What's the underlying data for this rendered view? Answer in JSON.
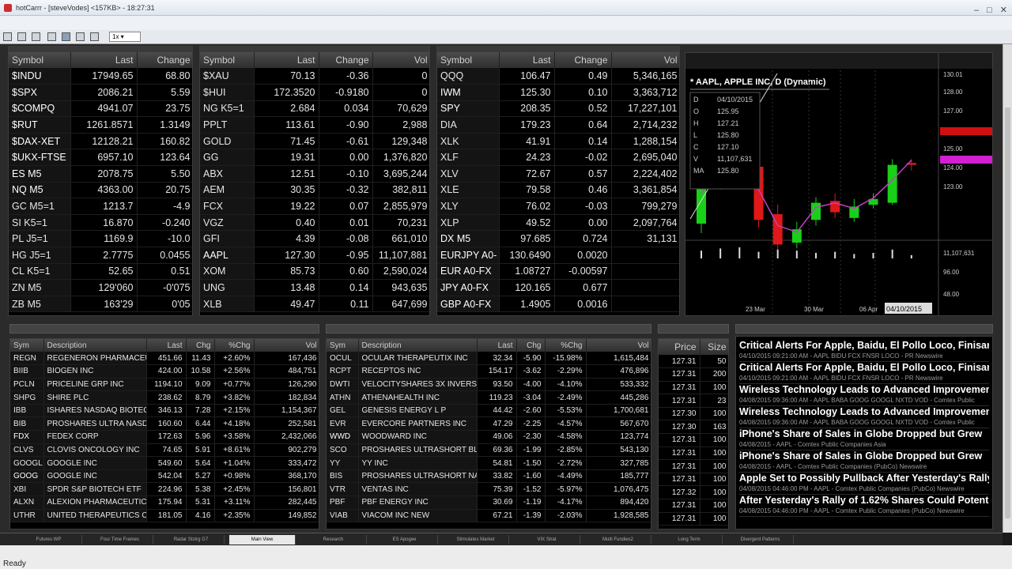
{
  "window": {
    "title": "hotCarrr - [steveVodes] <157KB> - 18:27:31"
  },
  "toolbar": {
    "zoom": "1x"
  },
  "watch1": {
    "headers": [
      "Symbol",
      "Last",
      "Change"
    ],
    "rows": [
      [
        "$INDU",
        "17949.65",
        "68.80",
        "g",
        "pos"
      ],
      [
        "$SPX",
        "2086.21",
        "5.59",
        "r",
        "pos"
      ],
      [
        "$COMPQ",
        "4941.07",
        "23.75",
        "r",
        "pos"
      ],
      [
        "$RUT",
        "1261.8571",
        "1.3149",
        "r",
        "pos"
      ],
      [
        "$DAX-XET",
        "12128.21",
        "160.82",
        "r",
        "pos"
      ],
      [
        "$UKX-FTSE",
        "6957.10",
        "123.64",
        "g",
        "pos"
      ],
      [
        "ES M5",
        "2078.75",
        "5.50",
        "g",
        "pos"
      ],
      [
        "NQ M5",
        "4363.00",
        "20.75",
        "g",
        "pos"
      ],
      [
        "GC M5=1",
        "1213.7",
        "-4.9",
        "d",
        "neg"
      ],
      [
        "SI K5=1",
        "16.870",
        "-0.240",
        "d",
        "neg"
      ],
      [
        "PL J5=1",
        "1169.9",
        "-10.0",
        "d",
        "neg"
      ],
      [
        "HG J5=1",
        "2.7775",
        "0.0455",
        "d",
        "pos"
      ],
      [
        "CL K5=1",
        "52.65",
        "0.51",
        "d",
        "pos"
      ],
      [
        "ZN M5",
        "129'060",
        "-0'075",
        "d",
        "neg"
      ],
      [
        "ZB M5",
        "163'29",
        "0'05",
        "d",
        "pos"
      ]
    ]
  },
  "watch2": {
    "headers": [
      "Symbol",
      "Last",
      "Change",
      "Vol"
    ],
    "rows": [
      [
        "$XAU",
        "70.13",
        "-0.36",
        "0",
        "d",
        "neg"
      ],
      [
        "$HUI",
        "172.3520",
        "-0.9180",
        "0",
        "d",
        "neg"
      ],
      [
        "NG K5=1",
        "2.684",
        "0.034",
        "70,629",
        "d",
        "pos"
      ],
      [
        "PPLT",
        "113.61",
        "-0.90",
        "2,988",
        "d",
        "neg"
      ],
      [
        "GOLD",
        "71.45",
        "-0.61",
        "129,348",
        "d",
        "neg"
      ],
      [
        "GG",
        "19.31",
        "0.00",
        "1,376,820",
        "d",
        "neu"
      ],
      [
        "ABX",
        "12.51",
        "-0.10",
        "3,695,244",
        "d",
        "neg"
      ],
      [
        "AEM",
        "30.35",
        "-0.32",
        "382,811",
        "d",
        "neg"
      ],
      [
        "FCX",
        "19.22",
        "0.07",
        "2,855,979",
        "d",
        "pos"
      ],
      [
        "VGZ",
        "0.40",
        "0.01",
        "70,231",
        "d",
        "pos"
      ],
      [
        "GFI",
        "4.39",
        "-0.08",
        "661,010",
        "d",
        "neg"
      ],
      [
        "AAPL",
        "127.30",
        "-0.95",
        "11,107,881",
        "r",
        "neg"
      ],
      [
        "XOM",
        "85.73",
        "0.60",
        "2,590,024",
        "d",
        "pos"
      ],
      [
        "UNG",
        "13.48",
        "0.14",
        "943,635",
        "d",
        "pos"
      ],
      [
        "XLB",
        "49.47",
        "0.11",
        "647,699",
        "d",
        "pos"
      ]
    ]
  },
  "watch3": {
    "headers": [
      "Symbol",
      "Last",
      "Change",
      "Vol"
    ],
    "rows": [
      [
        "QQQ",
        "106.47",
        "0.49",
        "5,346,165",
        "d",
        "pos"
      ],
      [
        "IWM",
        "125.30",
        "0.10",
        "3,363,712",
        "g",
        "pos"
      ],
      [
        "SPY",
        "208.35",
        "0.52",
        "17,227,101",
        "g",
        "pos"
      ],
      [
        "DIA",
        "179.23",
        "0.64",
        "2,714,232",
        "d",
        "pos"
      ],
      [
        "XLK",
        "41.91",
        "0.14",
        "1,288,154",
        "d",
        "pos"
      ],
      [
        "XLF",
        "24.23",
        "-0.02",
        "2,695,040",
        "d",
        "neg"
      ],
      [
        "XLV",
        "72.67",
        "0.57",
        "2,224,402",
        "d",
        "pos"
      ],
      [
        "XLE",
        "79.58",
        "0.46",
        "3,361,854",
        "d",
        "pos"
      ],
      [
        "XLY",
        "76.02",
        "-0.03",
        "799,279",
        "d",
        "neg"
      ],
      [
        "XLP",
        "49.52",
        "0.00",
        "2,097,764",
        "d",
        "neu"
      ],
      [
        "DX M5",
        "97.685",
        "0.724",
        "31,131",
        "g",
        "pos"
      ],
      [
        "EURJPY A0-",
        "130.6490",
        "0.0020",
        "",
        "r",
        "pos"
      ],
      [
        "EUR A0-FX",
        "1.08727",
        "-0.00597",
        "",
        "g",
        "neg"
      ],
      [
        "JPY A0-FX",
        "120.165",
        "0.677",
        "",
        "g",
        "pos"
      ],
      [
        "GBP A0-FX",
        "1.4905",
        "0.0016",
        "",
        "r",
        "pos"
      ]
    ]
  },
  "chart": {
    "title": "* AAPL, APPLE INC, D (Dynamic)",
    "date": "04/10/2015",
    "ohlc": [
      "D",
      "O",
      "H",
      "L",
      "C",
      "V",
      "MA"
    ],
    "ohlc_values": [
      "04/10/2015",
      "125.95",
      "127.21",
      "125.80",
      "127.10",
      "11,107,631",
      "125.80"
    ],
    "yaxis": [
      "130.01",
      "128.00",
      "127.00",
      "126.00",
      "125.00",
      "124.00",
      "123.00",
      "11,107,631",
      "96.00",
      "48.00"
    ],
    "xaxis": [
      "23 Mar",
      "30 Mar",
      "06 Apr",
      "04/10/2015"
    ],
    "candles": [
      [
        124.0,
        126.8,
        123.5,
        127.1
      ],
      [
        126.2,
        127.4,
        125.8,
        128.0
      ],
      [
        126.5,
        127.8,
        126.0,
        128.3
      ],
      [
        127.0,
        124.2,
        123.8,
        127.3
      ],
      [
        124.5,
        122.9,
        122.5,
        125.0
      ],
      [
        123.0,
        123.7,
        122.7,
        124.1
      ],
      [
        124.2,
        125.1,
        123.9,
        125.4
      ],
      [
        125.2,
        124.6,
        124.3,
        125.6
      ],
      [
        124.3,
        124.9,
        124.1,
        125.3
      ],
      [
        125.0,
        125.3,
        124.8,
        125.6
      ],
      [
        125.1,
        127.1,
        125.0,
        127.4
      ],
      [
        127.2,
        127.1,
        126.8,
        127.4
      ]
    ],
    "volumes": [
      0.7,
      0.9,
      1,
      0.6,
      0.8,
      0.7,
      0.5,
      0.6,
      0.4,
      0.5,
      0.8,
      0.3
    ]
  },
  "highlow": {
    "headers": [
      "Sym",
      "Description",
      "Last",
      "Chg",
      "%Chg",
      "Vol"
    ],
    "rows": [
      [
        "REGN",
        "REGENERON PHARMACEUT",
        "451.66",
        "11.43",
        "+2.60%",
        "167,436",
        "d",
        "pos"
      ],
      [
        "BIIB",
        "BIOGEN INC",
        "424.00",
        "10.58",
        "+2.56%",
        "484,751",
        "d",
        "pos"
      ],
      [
        "PCLN",
        "PRICELINE GRP INC",
        "1194.10",
        "9.09",
        "+0.77%",
        "126,290",
        "d",
        "pos"
      ],
      [
        "SHPG",
        "SHIRE PLC",
        "238.62",
        "8.79",
        "+3.82%",
        "182,834",
        "d",
        "pos"
      ],
      [
        "IBB",
        "ISHARES NASDAQ BIOTECH",
        "346.13",
        "7.28",
        "+2.15%",
        "1,154,367",
        "d",
        "pos"
      ],
      [
        "BIB",
        "PROSHARES ULTRA NASDAQ",
        "160.60",
        "6.44",
        "+4.18%",
        "252,581",
        "d",
        "pos"
      ],
      [
        "FDX",
        "FEDEX CORP",
        "172.63",
        "5.96",
        "+3.58%",
        "2,432,066",
        "r",
        "pos"
      ],
      [
        "CLVS",
        "CLOVIS ONCOLOGY INC",
        "74.65",
        "5.91",
        "+8.61%",
        "902,279",
        "d",
        "pos"
      ],
      [
        "GOOGL",
        "GOOGLE INC",
        "549.60",
        "5.64",
        "+1.04%",
        "333,472",
        "d",
        "pos"
      ],
      [
        "GOOG",
        "GOOGLE INC",
        "542.04",
        "5.27",
        "+0.98%",
        "368,170",
        "g",
        "pos"
      ],
      [
        "XBI",
        "SPDR S&P BIOTECH ETF",
        "224.96",
        "5.38",
        "+2.45%",
        "156,801",
        "d",
        "pos"
      ],
      [
        "ALXN",
        "ALEXION PHARMACEUTICAL",
        "175.94",
        "5.31",
        "+3.11%",
        "282,445",
        "d",
        "pos"
      ],
      [
        "UTHR",
        "UNITED THERAPEUTICS COR",
        "181.05",
        "4.16",
        "+2.35%",
        "149,852",
        "d",
        "pos"
      ]
    ]
  },
  "losers": {
    "headers": [
      "Sym",
      "Description",
      "Last",
      "Chg",
      "%Chg",
      "Vol"
    ],
    "rows": [
      [
        "OCUL",
        "OCULAR THERAPEUTIX INC",
        "32.34",
        "-5.90",
        "-15.98%",
        "1,615,484",
        "d",
        "neg"
      ],
      [
        "RCPT",
        "RECEPTOS INC",
        "154.17",
        "-3.62",
        "-2.29%",
        "476,896",
        "d",
        "neg"
      ],
      [
        "DWTI",
        "VELOCITYSHARES 3X INVERS",
        "93.50",
        "-4.00",
        "-4.10%",
        "533,332",
        "d",
        "neg"
      ],
      [
        "ATHN",
        "ATHENAHEALTH INC",
        "119.23",
        "-3.04",
        "-2.49%",
        "445,286",
        "d",
        "neg"
      ],
      [
        "GEL",
        "GENESIS ENERGY L P",
        "44.42",
        "-2.60",
        "-5.53%",
        "1,700,681",
        "d",
        "neg"
      ],
      [
        "EVR",
        "EVERCORE PARTNERS INC",
        "47.29",
        "-2.25",
        "-4.57%",
        "567,670",
        "d",
        "neg"
      ],
      [
        "WWD",
        "WOODWARD INC",
        "49.06",
        "-2.30",
        "-4.58%",
        "123,774",
        "g",
        "neg"
      ],
      [
        "SCO",
        "PROSHARES ULTRASHORT BL",
        "69.36",
        "-1.99",
        "-2.85%",
        "543,130",
        "d",
        "neg"
      ],
      [
        "YY",
        "YY INC",
        "54.81",
        "-1.50",
        "-2.72%",
        "327,785",
        "d",
        "neg"
      ],
      [
        "BIS",
        "PROSHARES ULTRASHORT NA",
        "33.82",
        "-1.60",
        "-4.49%",
        "185,777",
        "d",
        "neg"
      ],
      [
        "VTR",
        "VENTAS INC",
        "75.39",
        "-1.52",
        "-5.97%",
        "1,076,475",
        "d",
        "neg"
      ],
      [
        "PBF",
        "PBF ENERGY INC",
        "30.69",
        "-1.19",
        "-4.17%",
        "894,420",
        "d",
        "neg"
      ],
      [
        "VIAB",
        "VIACOM INC NEW",
        "67.21",
        "-1.39",
        "-2.03%",
        "1,928,585",
        "d",
        "neg"
      ]
    ]
  },
  "timesales": {
    "headers": [
      "Price",
      "Size"
    ],
    "rows": [
      [
        "127.31",
        "50"
      ],
      [
        "127.31",
        "200"
      ],
      [
        "127.31",
        "100"
      ],
      [
        "127.31",
        "23"
      ],
      [
        "127.30",
        "100"
      ],
      [
        "127.30",
        "163"
      ],
      [
        "127.31",
        "100"
      ],
      [
        "127.31",
        "100"
      ],
      [
        "127.31",
        "100"
      ],
      [
        "127.31",
        "100"
      ],
      [
        "127.32",
        "100"
      ],
      [
        "127.31",
        "100"
      ],
      [
        "127.31",
        "100"
      ]
    ]
  },
  "news": [
    {
      "headline": "Critical Alerts For Apple, Baidu, El Pollo Loco, Finisar",
      "meta": "04/10/2015 09:21:00 AM - AAPL BIDU FCX FNSR LOCO - PR Newswire"
    },
    {
      "headline": "Critical Alerts For Apple, Baidu, El Pollo Loco, Finisar",
      "meta": "04/10/2015 09:21:00 AM - AAPL BIDU FCX FNSR LOCO - PR Newswire"
    },
    {
      "headline": "Wireless Technology Leads to Advanced Improvements",
      "meta": "04/08/2015 09:36:00 AM - AAPL BABA GOOG GOOGL NXTD VOD - Comtex Public"
    },
    {
      "headline": "Wireless Technology Leads to Advanced Improvements",
      "meta": "04/08/2015 09:36:00 AM - AAPL BABA GOOG GOOGL NXTD VOD - Comtex Public"
    },
    {
      "headline": "iPhone's Share of Sales in Globe Dropped but Grew",
      "meta": "04/08/2015 - AAPL - Comtex Public Companies Asia"
    },
    {
      "headline": "iPhone's Share of Sales in Globe Dropped but Grew",
      "meta": "04/08/2015 - AAPL - Comtex Public Companies (PubCo) Newswire"
    },
    {
      "headline": "Apple Set to Possibly Pullback After Yesterday's Rally",
      "meta": "04/08/2015 04:46:00 PM - AAPL - Comtex Public Companies (PubCo) Newswire"
    },
    {
      "headline": "After Yesterday's Rally of 1.62% Shares Could Potentially",
      "meta": "04/08/2015 04:46:00 PM - AAPL - Comtex Public Companies (PubCo) Newswire"
    }
  ],
  "tabs": [
    "Futures WP",
    "Four Time Frames",
    "Radar Ststrg G7",
    "Main View",
    "Research",
    "ES Apogee",
    "Stimulates Market",
    "VIX Strat",
    "Multi Fundies2",
    "Long Term",
    "Divergent Patterns"
  ],
  "status": {
    "ready": "Ready"
  }
}
